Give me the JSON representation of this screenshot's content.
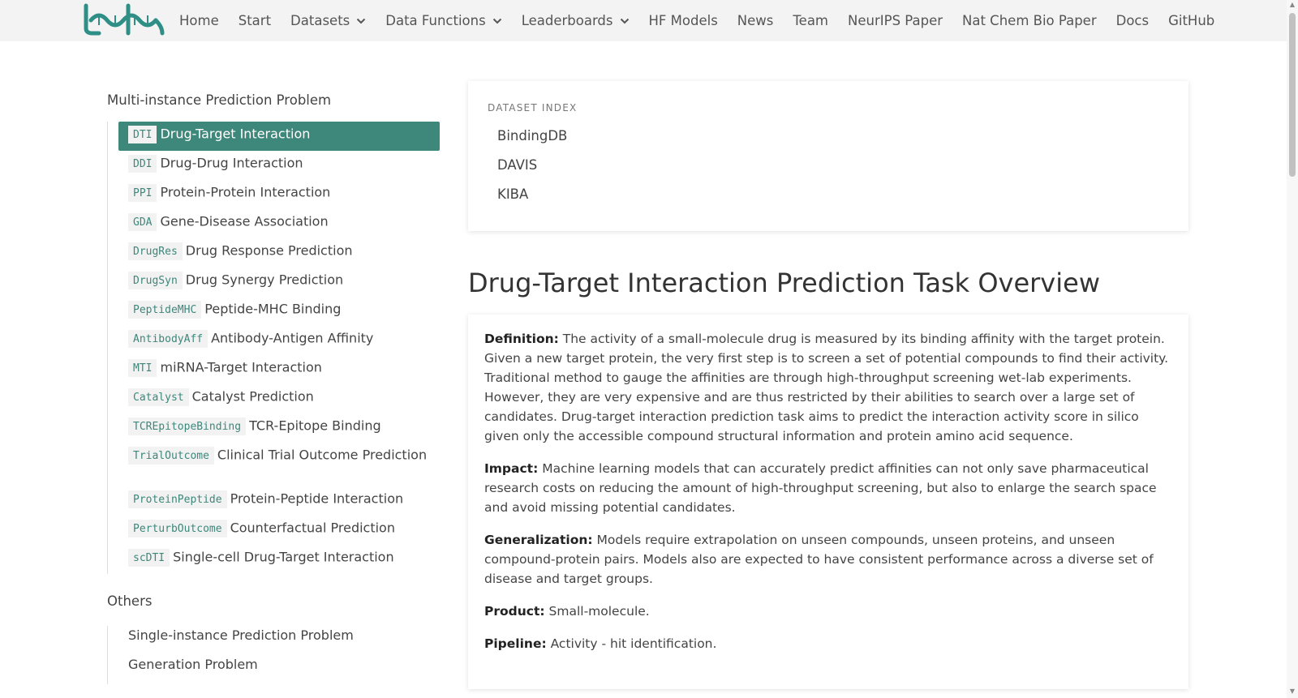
{
  "nav": {
    "items": [
      {
        "label": "Home",
        "dropdown": false
      },
      {
        "label": "Start",
        "dropdown": false
      },
      {
        "label": "Datasets",
        "dropdown": true
      },
      {
        "label": "Data Functions",
        "dropdown": true
      },
      {
        "label": "Leaderboards",
        "dropdown": true
      },
      {
        "label": "HF Models",
        "dropdown": false
      },
      {
        "label": "News",
        "dropdown": false
      },
      {
        "label": "Team",
        "dropdown": false
      },
      {
        "label": "NeurIPS Paper",
        "dropdown": false
      },
      {
        "label": "Nat Chem Bio Paper",
        "dropdown": false
      },
      {
        "label": "Docs",
        "dropdown": false
      },
      {
        "label": "GitHub",
        "dropdown": false
      }
    ]
  },
  "sidebar": {
    "heading": "Multi-instance Prediction Problem",
    "items": [
      {
        "code": "DTI",
        "label": "Drug-Target Interaction",
        "active": true
      },
      {
        "code": "DDI",
        "label": "Drug-Drug Interaction"
      },
      {
        "code": "PPI",
        "label": "Protein-Protein Interaction"
      },
      {
        "code": "GDA",
        "label": "Gene-Disease Association"
      },
      {
        "code": "DrugRes",
        "label": "Drug Response Prediction"
      },
      {
        "code": "DrugSyn",
        "label": "Drug Synergy Prediction"
      },
      {
        "code": "PeptideMHC",
        "label": "Peptide-MHC Binding"
      },
      {
        "code": "AntibodyAff",
        "label": "Antibody-Antigen Affinity"
      },
      {
        "code": "MTI",
        "label": "miRNA-Target Interaction"
      },
      {
        "code": "Catalyst",
        "label": "Catalyst Prediction"
      },
      {
        "code": "TCREpitopeBinding",
        "label": "TCR-Epitope Binding"
      },
      {
        "code": "TrialOutcome",
        "label": "Clinical Trial Outcome Prediction"
      },
      {
        "code": "ProteinPeptide",
        "label": "Protein-Peptide Interaction"
      },
      {
        "code": "PerturbOutcome",
        "label": "Counterfactual Prediction"
      },
      {
        "code": "scDTI",
        "label": "Single-cell Drug-Target Interaction"
      }
    ],
    "others_heading": "Others",
    "others": [
      "Single-instance Prediction Problem",
      "Generation Problem"
    ]
  },
  "index": {
    "label": "DATASET INDEX",
    "items": [
      "BindingDB",
      "DAVIS",
      "KIBA"
    ]
  },
  "main": {
    "title": "Drug-Target Interaction Prediction Task Overview",
    "sections": [
      {
        "term": "Definition:",
        "text": "The activity of a small-molecule drug is measured by its binding affinity with the target protein. Given a new target protein, the very first step is to screen a set of potential compounds to find their activity. Traditional method to gauge the affinities are through high-throughput screening wet-lab experiments. However, they are very expensive and are thus restricted by their abilities to search over a large set of candidates. Drug-target interaction prediction task aims to predict the interaction activity score in silico given only the accessible compound structural information and protein amino acid sequence."
      },
      {
        "term": "Impact:",
        "text": "Machine learning models that can accurately predict affinities can not only save pharmaceutical research costs on reducing the amount of high-throughput screening, but also to enlarge the search space and avoid missing potential candidates."
      },
      {
        "term": "Generalization:",
        "text": "Models require extrapolation on unseen compounds, unseen proteins, and unseen compound-protein pairs. Models also are expected to have consistent performance across a diverse set of disease and target groups."
      },
      {
        "term": "Product:",
        "text": "Small-molecule."
      },
      {
        "term": "Pipeline:",
        "text": "Activity - hit identification."
      }
    ]
  },
  "colors": {
    "accent": "#3d877b",
    "navbar_bg": "#f3f3f3"
  }
}
